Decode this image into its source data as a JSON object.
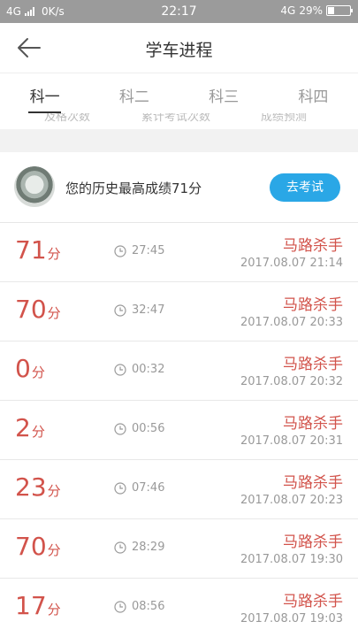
{
  "status": {
    "network": "4G",
    "speed": "0K/s",
    "time": "22:17",
    "network_right": "4G",
    "battery": "29%",
    "battery_level": 0.29
  },
  "header": {
    "title": "学车进程",
    "back_icon": "arrow-left-icon"
  },
  "tabs": [
    {
      "label": "科一",
      "active": true
    },
    {
      "label": "科二",
      "active": false
    },
    {
      "label": "科三",
      "active": false
    },
    {
      "label": "科四",
      "active": false
    }
  ],
  "stats": {
    "labels": [
      "及格次数",
      "累计考试次数",
      "成绩预测"
    ]
  },
  "best": {
    "text": "您的历史最高成绩71分",
    "button": "去考试"
  },
  "records": [
    {
      "score": "71",
      "unit": "分",
      "duration": "27:45",
      "user": "马路杀手",
      "date": "2017.08.07  21:14"
    },
    {
      "score": "70",
      "unit": "分",
      "duration": "32:47",
      "user": "马路杀手",
      "date": "2017.08.07  20:33"
    },
    {
      "score": "0",
      "unit": "分",
      "duration": "00:32",
      "user": "马路杀手",
      "date": "2017.08.07  20:32"
    },
    {
      "score": "2",
      "unit": "分",
      "duration": "00:56",
      "user": "马路杀手",
      "date": "2017.08.07  20:31"
    },
    {
      "score": "23",
      "unit": "分",
      "duration": "07:46",
      "user": "马路杀手",
      "date": "2017.08.07  20:23"
    },
    {
      "score": "70",
      "unit": "分",
      "duration": "28:29",
      "user": "马路杀手",
      "date": "2017.08.07  19:30"
    },
    {
      "score": "17",
      "unit": "分",
      "duration": "08:56",
      "user": "马路杀手",
      "date": "2017.08.07  19:03"
    }
  ]
}
